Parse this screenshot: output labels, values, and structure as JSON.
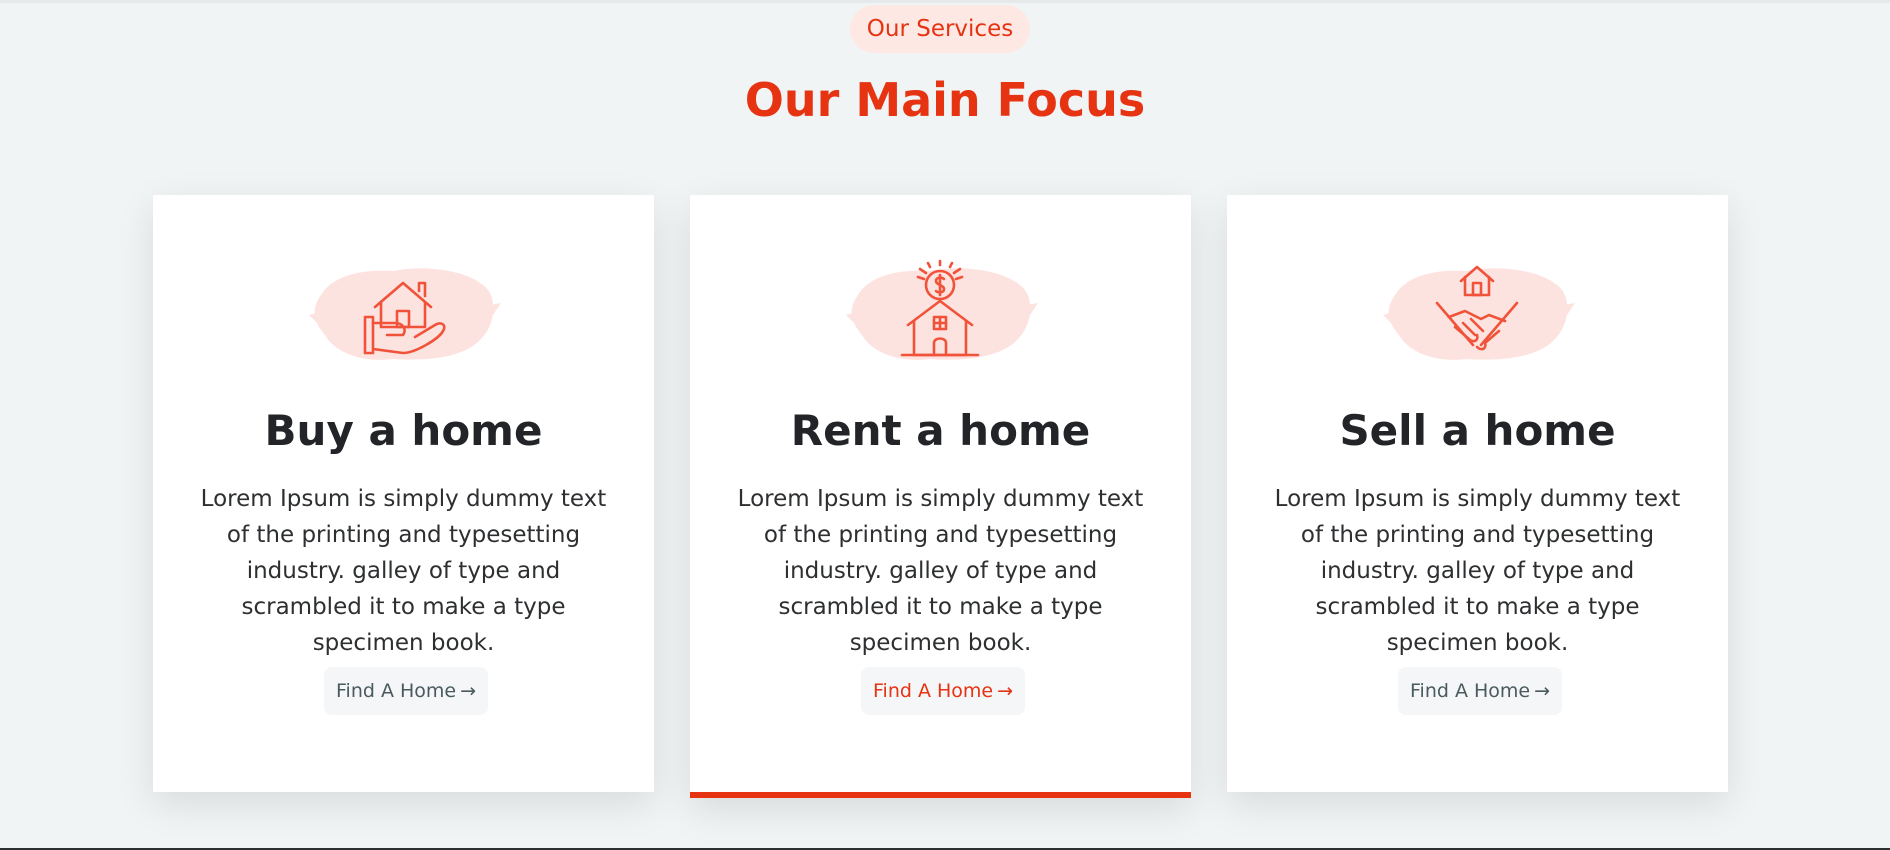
{
  "section": {
    "tag": "Our Services",
    "title": "Our Main Focus"
  },
  "colors": {
    "accent": "#e63312",
    "accent_light": "#fde8e4",
    "background": "#f1f4f5"
  },
  "cards": [
    {
      "icon": "hand-holding-house-icon",
      "title": "Buy a home",
      "text": "Lorem Ipsum is simply dummy text of the printing and typesetting industry. galley of type and scrambled it to make a type specimen book.",
      "button_label": "Find A Home",
      "arrow": "→",
      "active": false
    },
    {
      "icon": "house-with-coin-icon",
      "title": "Rent a home",
      "text": "Lorem Ipsum is simply dummy text of the printing and typesetting industry. galley of type and scrambled it to make a type specimen book.",
      "button_label": "Find A Home",
      "arrow": "→",
      "active": true
    },
    {
      "icon": "handshake-house-icon",
      "title": "Sell a home",
      "text": "Lorem Ipsum is simply dummy text of the printing and typesetting industry. galley of type and scrambled it to make a type specimen book.",
      "button_label": "Find A Home",
      "arrow": "→",
      "active": false
    }
  ]
}
